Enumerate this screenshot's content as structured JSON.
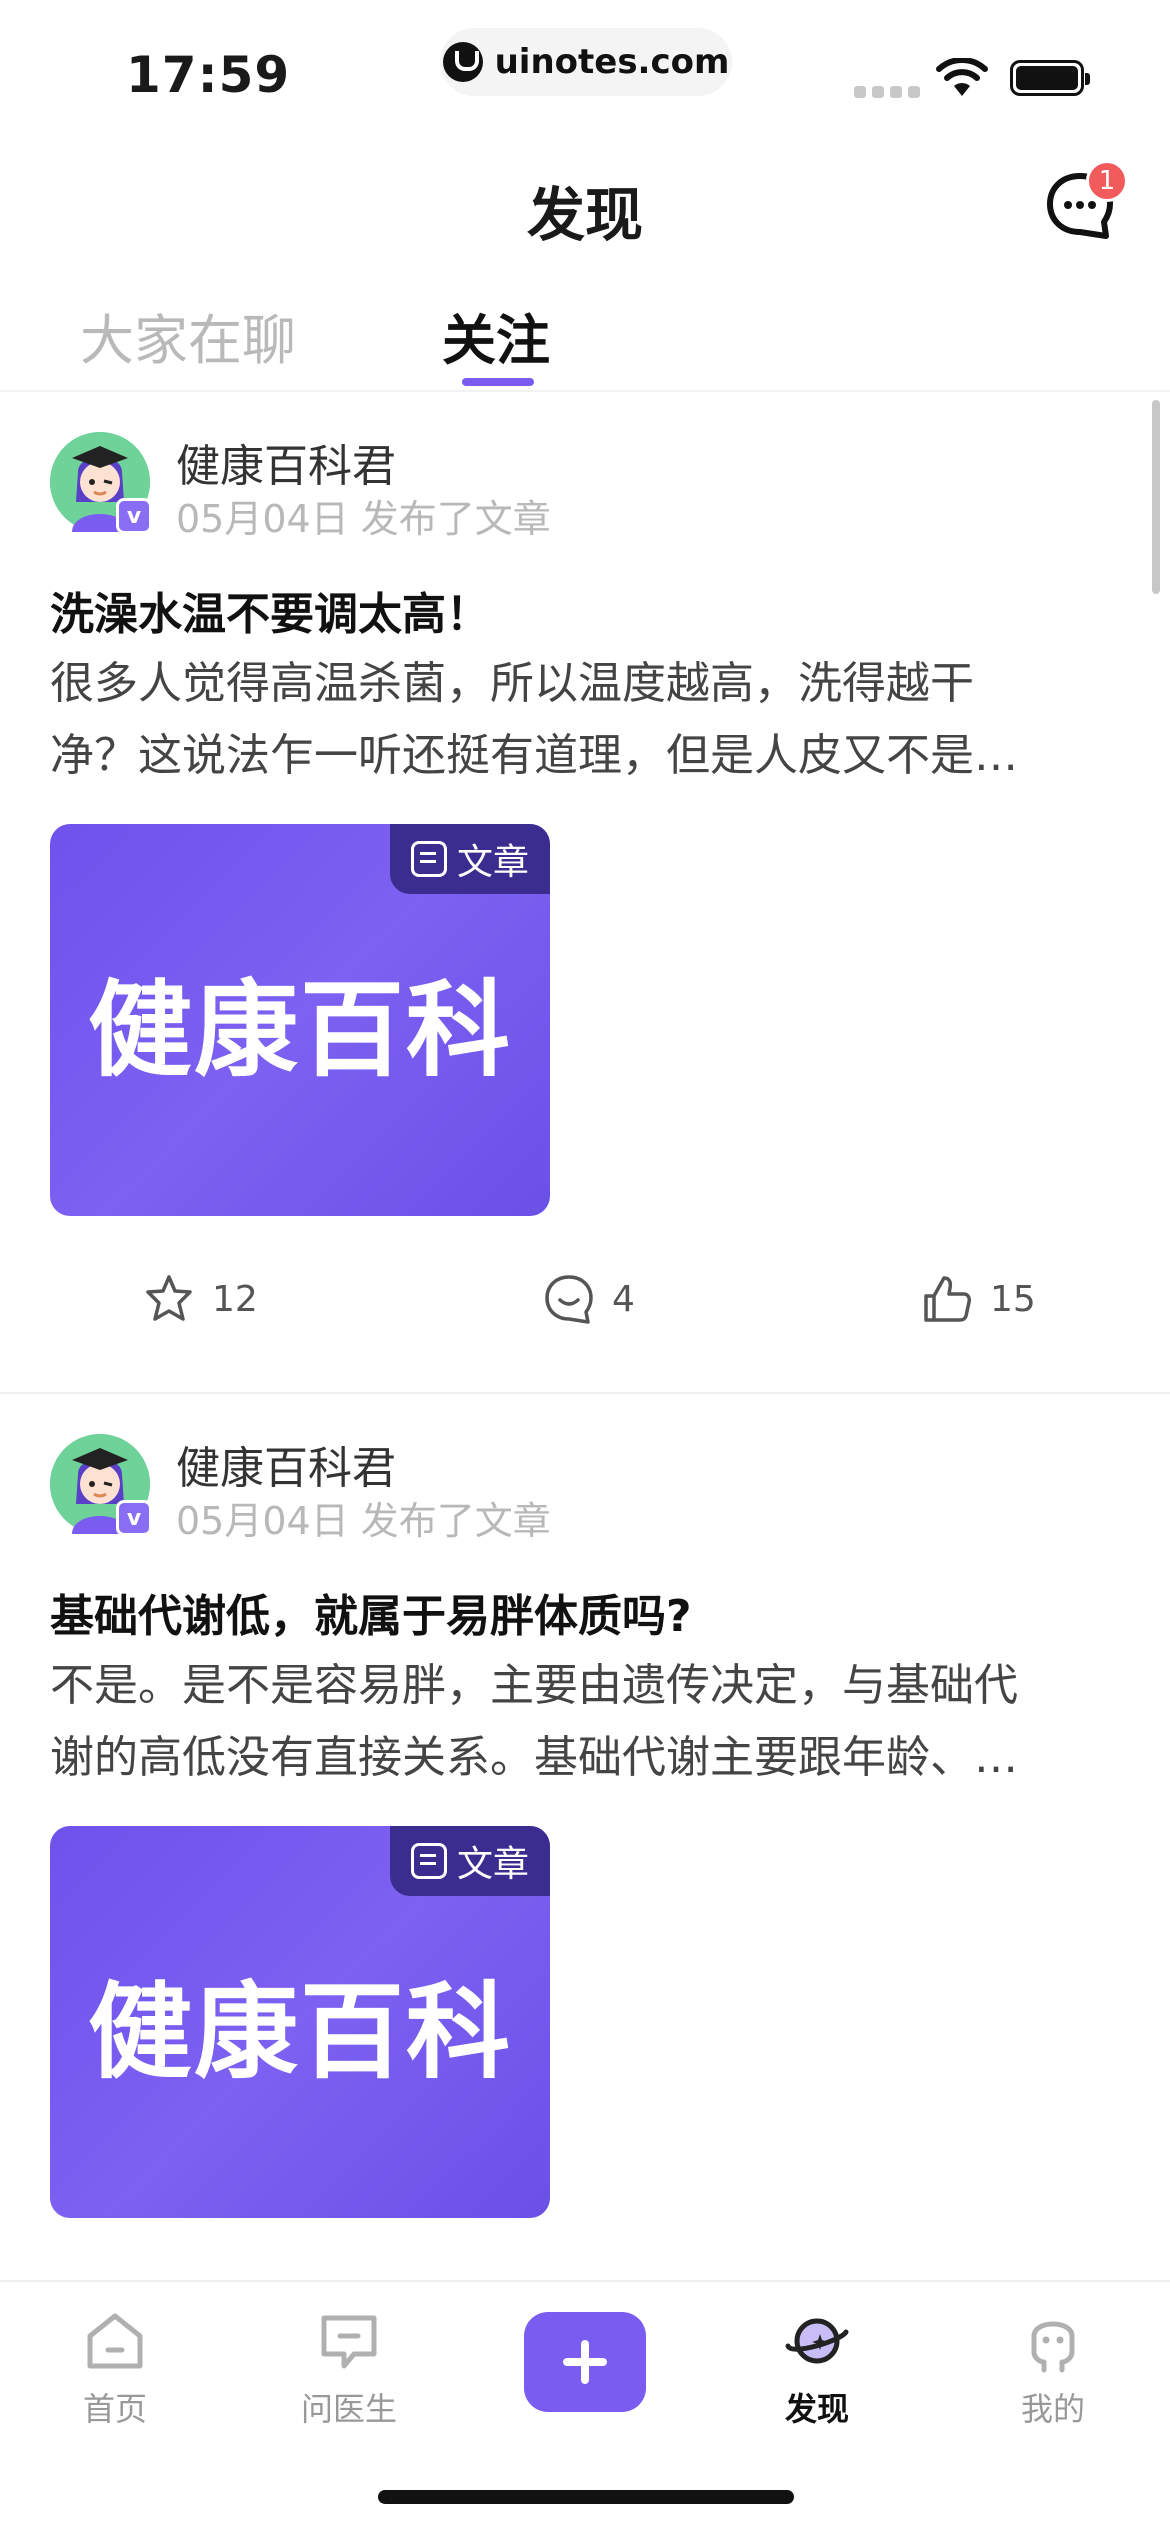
{
  "status_bar": {
    "time": "17:59",
    "url": "uinotes.com"
  },
  "header": {
    "title": "发现",
    "message_badge": "1",
    "message_icon": "chat-bubble-icon"
  },
  "tabs": [
    {
      "label": "大家在聊",
      "active": false
    },
    {
      "label": "关注",
      "active": true
    }
  ],
  "posts": [
    {
      "author": "健康百科君",
      "verified_badge": "v",
      "meta": "05月04日 发布了文章",
      "title": "洗澡水温不要调太高！",
      "body": "很多人觉得高温杀菌，所以温度越高，洗得越干\n净？这说法乍一听还挺有道理，但是人皮又不是…",
      "thumbnail_text": "健康百科",
      "thumbnail_tag": "文章",
      "favorites": "12",
      "comments": "4",
      "likes": "15"
    },
    {
      "author": "健康百科君",
      "verified_badge": "v",
      "meta": "05月04日 发布了文章",
      "title": "基础代谢低，就属于易胖体质吗?",
      "body": "不是。是不是容易胖，主要由遗传决定，与基础代\n谢的高低没有直接关系。基础代谢主要跟年龄、…",
      "thumbnail_text": "健康百科",
      "thumbnail_tag": "文章"
    }
  ],
  "bottom_nav": [
    {
      "label": "首页",
      "icon": "home-icon",
      "active": false
    },
    {
      "label": "问医生",
      "icon": "ask-doctor-icon",
      "active": false
    },
    {
      "label": "发现",
      "icon": "planet-icon",
      "active": true
    },
    {
      "label": "我的",
      "icon": "profile-icon",
      "active": false
    }
  ],
  "colors": {
    "accent": "#7b5cf0",
    "badge": "#f25b5b",
    "thumbnail": "#6e52ec"
  }
}
